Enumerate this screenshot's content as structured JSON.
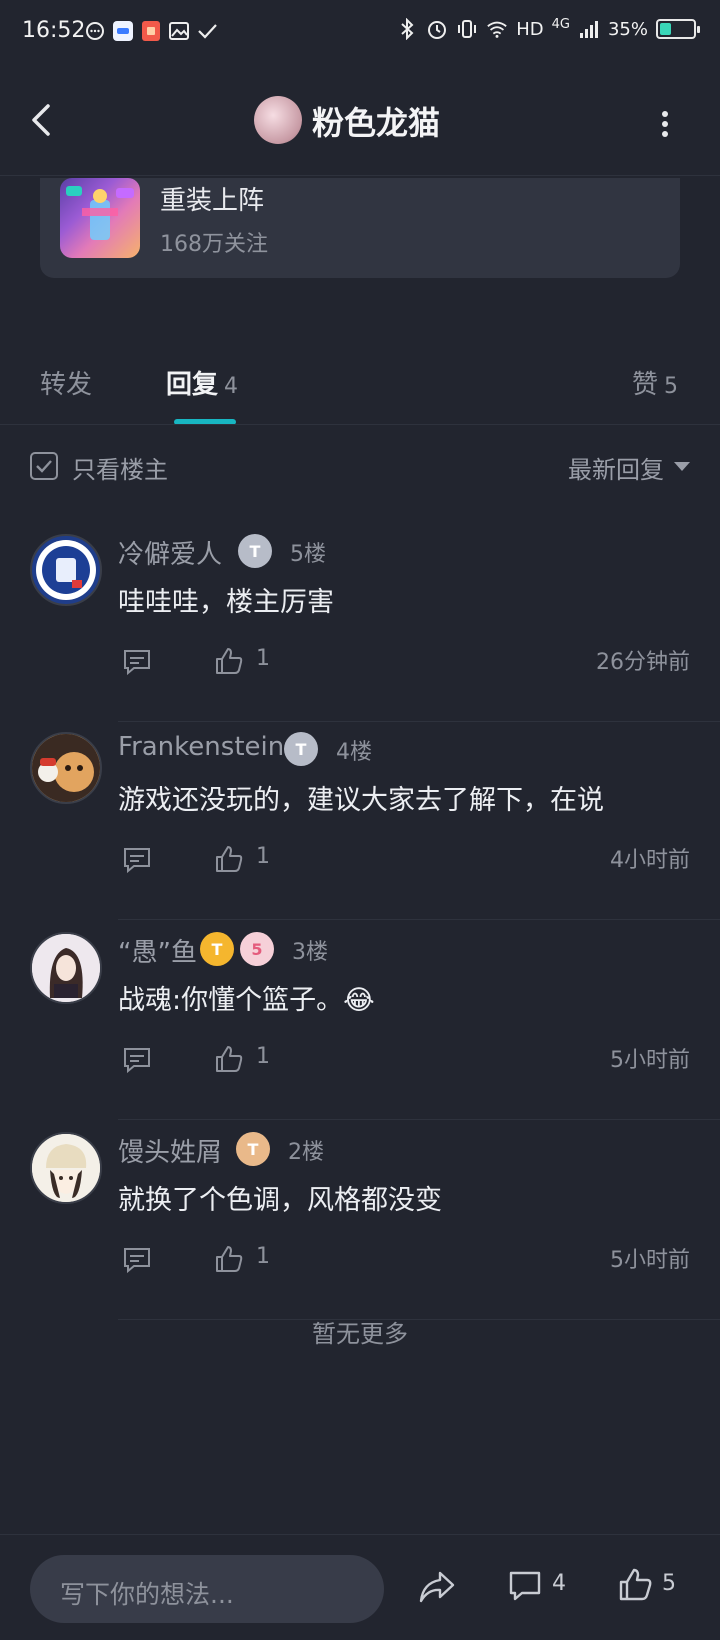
{
  "status_bar": {
    "time": "16:52",
    "network": "HD",
    "signal": "4G",
    "battery": "35%",
    "battery_level": 0.35
  },
  "header": {
    "title": "粉色龙猫",
    "back_icon": "chevron-left-icon",
    "more_icon": "more-vertical-icon"
  },
  "forum": {
    "name": "重装上阵",
    "followers": "168万关注"
  },
  "tabs": [
    {
      "label": "转发",
      "count": ""
    },
    {
      "label": "回复",
      "count": "4"
    },
    {
      "label": "赞",
      "count": "5"
    }
  ],
  "filter": {
    "only_op_label": "只看楼主",
    "sort_label": "最新回复"
  },
  "replies": [
    {
      "name": "冷僻爱人",
      "floor": "5楼",
      "content": "哇哇哇，楼主厉害",
      "likes": "1",
      "time": "26分钟前"
    },
    {
      "name": "Frankenstein",
      "floor": "4楼",
      "content": "游戏还没玩的，建议大家去了解下，在说",
      "likes": "1",
      "time": "4小时前"
    },
    {
      "name": "“愚”鱼",
      "floor": "3楼",
      "content": "战魂:你懂个篮子。😂",
      "likes": "1",
      "time": "5小时前"
    },
    {
      "name": "馒头姓屑",
      "floor": "2楼",
      "content": "就换了个色调，风格都没变",
      "likes": "1",
      "time": "5小时前"
    }
  ],
  "no_more": "暂无更多",
  "bottom_bar": {
    "input_placeholder": "写下你的想法...",
    "comment_count": "4",
    "like_count": "5"
  },
  "colors": {
    "background": "#22252f",
    "accent": "#18b6c2",
    "card": "#313541"
  }
}
